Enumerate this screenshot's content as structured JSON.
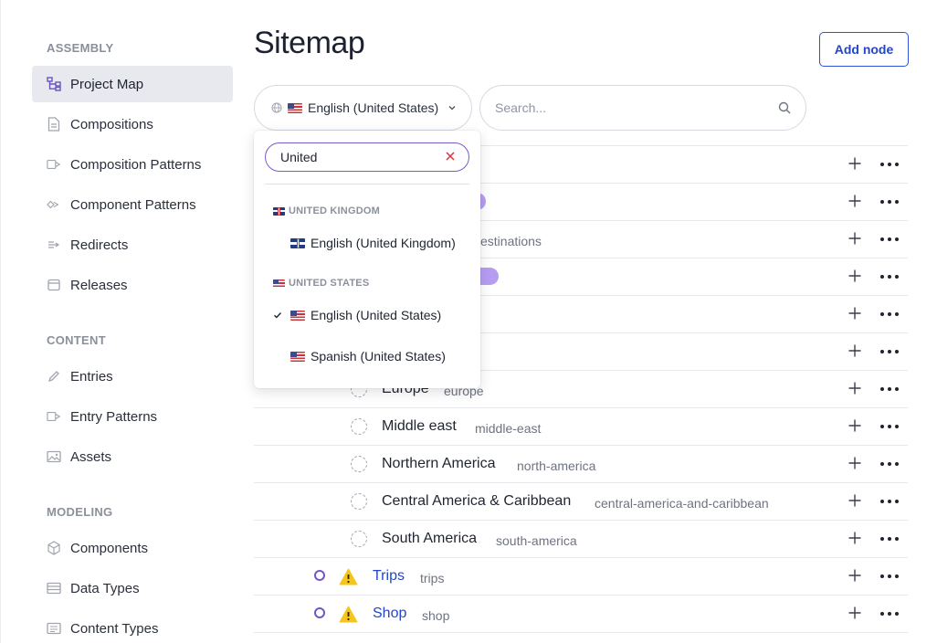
{
  "sidebar": {
    "sections": [
      {
        "label": "ASSEMBLY",
        "items": [
          {
            "label": "Project Map",
            "icon": "project-map-icon",
            "active": true
          },
          {
            "label": "Compositions",
            "icon": "document-icon"
          },
          {
            "label": "Composition Patterns",
            "icon": "pattern-icon"
          },
          {
            "label": "Component Patterns",
            "icon": "component-pattern-icon"
          },
          {
            "label": "Redirects",
            "icon": "redirect-icon"
          },
          {
            "label": "Releases",
            "icon": "calendar-icon"
          }
        ]
      },
      {
        "label": "CONTENT",
        "items": [
          {
            "label": "Entries",
            "icon": "pencil-icon"
          },
          {
            "label": "Entry Patterns",
            "icon": "entry-pattern-icon"
          },
          {
            "label": "Assets",
            "icon": "image-icon"
          }
        ]
      },
      {
        "label": "MODELING",
        "items": [
          {
            "label": "Components",
            "icon": "cube-icon"
          },
          {
            "label": "Data Types",
            "icon": "table-icon"
          },
          {
            "label": "Content Types",
            "icon": "list-icon"
          }
        ]
      }
    ]
  },
  "header": {
    "title": "Sitemap",
    "add_node_label": "Add node"
  },
  "locale_select": {
    "value": "English (United States)"
  },
  "search": {
    "placeholder": "Search..."
  },
  "dropdown": {
    "filter_value": "United",
    "groups": [
      {
        "label": "UNITED KINGDOM",
        "flag": "uk",
        "options": [
          {
            "label": "English (United Kingdom)",
            "flag": "uk",
            "selected": false
          }
        ]
      },
      {
        "label": "UNITED STATES",
        "flag": "us",
        "options": [
          {
            "label": "English (United States)",
            "flag": "us",
            "selected": true
          },
          {
            "label": "Spanish (United States)",
            "flag": "us",
            "selected": false
          }
        ]
      }
    ]
  },
  "rows": [
    {
      "title": "",
      "slug": ""
    },
    {
      "title": "",
      "slug": ""
    },
    {
      "title": "",
      "slug": "estinations"
    },
    {
      "title": "",
      "slug": ""
    },
    {
      "title": "",
      "slug": ""
    },
    {
      "title": "",
      "slug": ""
    },
    {
      "title": "Europe",
      "slug": "europe"
    },
    {
      "title": "Middle east",
      "slug": "middle-east"
    },
    {
      "title": "Northern America",
      "slug": "north-america"
    },
    {
      "title": "Central America & Caribbean",
      "slug": "central-america-and-caribbean"
    },
    {
      "title": "South America",
      "slug": "south-america"
    },
    {
      "title": "Trips",
      "slug": "trips"
    },
    {
      "title": "Shop",
      "slug": "shop"
    }
  ],
  "colors": {
    "accent": "#2545c9",
    "focus_ring": "#7a5ac9",
    "badge": "#b79cf2",
    "warning": "#f5c518"
  }
}
